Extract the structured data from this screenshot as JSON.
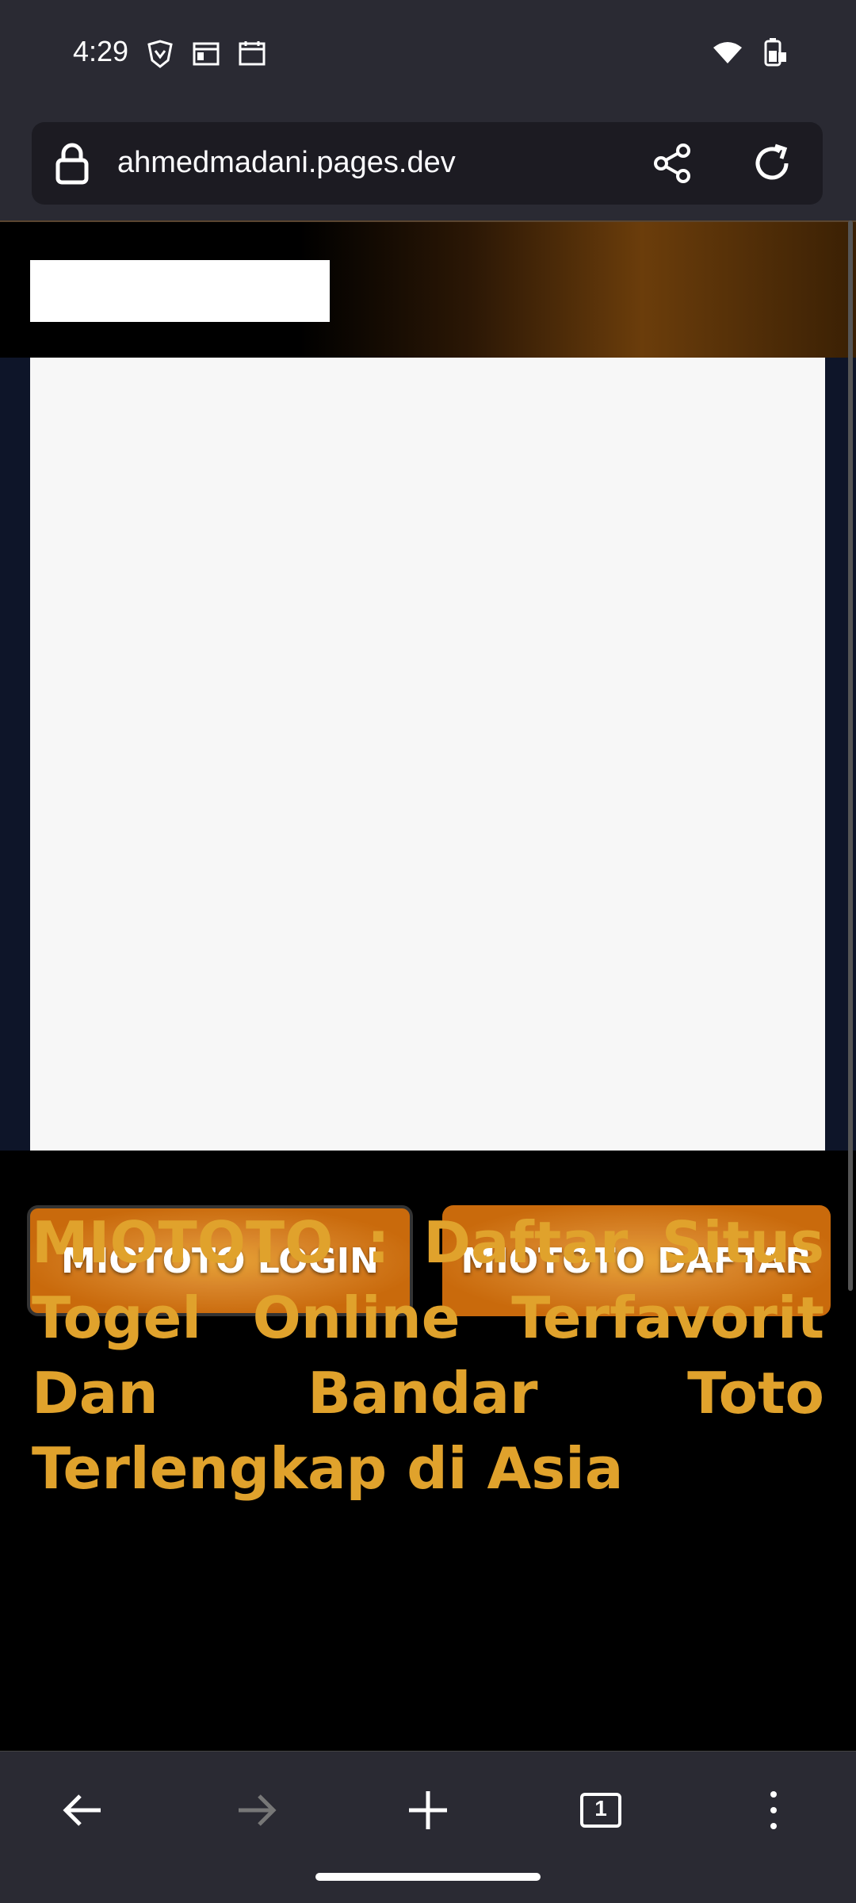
{
  "status_bar": {
    "time": "4:29"
  },
  "browser": {
    "url": "ahmedmadani.pages.dev",
    "tab_count": "1"
  },
  "page": {
    "buttons": {
      "login": "MIOTOTO LOGIN",
      "register": "MIOTOTO DAFTAR"
    },
    "headline": "MIOTOTO : Daftar Situs Togel Online Terfavorit Dan Bandar Toto Terlengkap di Asia"
  },
  "colors": {
    "accent_gold": "#e0a22c",
    "button_orange": "#c96a0c",
    "chrome_bg": "#2a2a33"
  }
}
